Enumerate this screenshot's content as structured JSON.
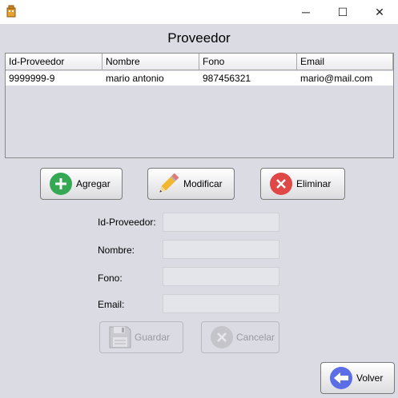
{
  "window": {
    "minimize_glyph": "─",
    "maximize_glyph": "☐",
    "close_glyph": "✕"
  },
  "title": "Proveedor",
  "table": {
    "columns": [
      "Id-Proveedor",
      "Nombre",
      "Fono",
      "Email"
    ],
    "rows": [
      [
        "9999999-9",
        "mario antonio",
        "987456321",
        "mario@mail.com"
      ]
    ]
  },
  "actions": {
    "agregar": "Agregar",
    "modificar": "Modificar",
    "eliminar": "Eliminar"
  },
  "form": {
    "id_label": "Id-Proveedor:",
    "id_value": "",
    "nombre_label": "Nombre:",
    "nombre_value": "",
    "fono_label": "Fono:",
    "fono_value": "",
    "email_label": "Email:",
    "email_value": ""
  },
  "form_actions": {
    "guardar": "Guardar",
    "cancelar": "Cancelar"
  },
  "volver": "Volver",
  "colors": {
    "agregar_icon": "#35a853",
    "eliminar_icon": "#e04848",
    "volver_icon": "#5b6ee8",
    "background": "#dadbe3"
  },
  "icons": {
    "app": "app-icon",
    "agregar": "plus-circle-icon",
    "modificar": "pencil-icon",
    "eliminar": "x-circle-icon",
    "guardar": "floppy-disk-icon",
    "cancelar": "cancel-circle-icon",
    "volver": "arrow-left-icon"
  }
}
